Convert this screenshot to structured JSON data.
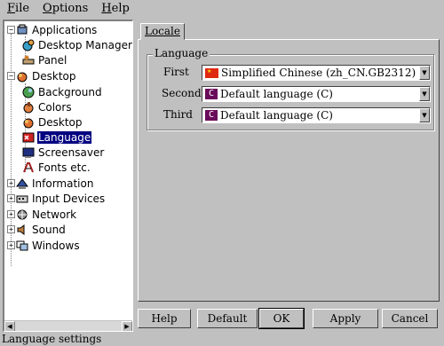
{
  "menubar": {
    "items": [
      {
        "label": "File",
        "mnemonic": "F",
        "rest": "ile"
      },
      {
        "label": "Options",
        "mnemonic": "O",
        "rest": "ptions"
      },
      {
        "label": "Help",
        "mnemonic": "H",
        "rest": "elp"
      }
    ]
  },
  "tree": {
    "applications": "Applications",
    "desktop_manager": "Desktop Manager",
    "panel": "Panel",
    "desktop": "Desktop",
    "background": "Background",
    "colors": "Colors",
    "desktop_sub": "Desktop",
    "language": "Language",
    "screensaver": "Screensaver",
    "fonts": "Fonts etc.",
    "information": "Information",
    "input_devices": "Input Devices",
    "network": "Network",
    "sound": "Sound",
    "windows": "Windows"
  },
  "tab": {
    "label": "Locale"
  },
  "language_group": {
    "title": "Language",
    "first_label": "First",
    "first_value": "Simplified Chinese (zh_CN.GB2312)",
    "second_label": "Second",
    "second_value": "Default language (C)",
    "third_label": "Third",
    "third_value": "Default language (C)",
    "c_badge": "C"
  },
  "buttons": {
    "help": "Help",
    "default": "Default",
    "ok": "OK",
    "apply": "Apply",
    "cancel": "Cancel"
  },
  "statusbar": {
    "text": "Language settings"
  },
  "colors": {
    "selection": "#000080",
    "background": "#c0c0c0"
  }
}
